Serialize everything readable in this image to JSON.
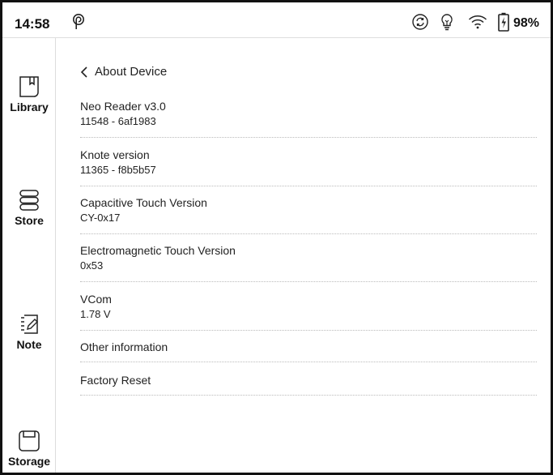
{
  "status_bar": {
    "time": "14:58",
    "battery_percent": "98%",
    "icons": [
      "push-notification-icon",
      "sync-icon",
      "lightbulb-icon",
      "wifi-icon",
      "battery-charging-icon"
    ]
  },
  "sidebar": {
    "items": [
      {
        "label": "Library",
        "icon": "library-icon"
      },
      {
        "label": "Store",
        "icon": "store-icon"
      },
      {
        "label": "Note",
        "icon": "note-icon"
      },
      {
        "label": "Storage",
        "icon": "storage-icon"
      }
    ]
  },
  "page": {
    "back_label": "About Device",
    "rows": [
      {
        "title": "Neo Reader v3.0",
        "value": "11548 - 6af1983"
      },
      {
        "title": "Knote version",
        "value": "11365 - f8b5b57"
      },
      {
        "title": "Capacitive Touch Version",
        "value": "CY-0x17"
      },
      {
        "title": "Electromagnetic Touch Version",
        "value": "0x53"
      },
      {
        "title": "VCom",
        "value": "1.78 V"
      },
      {
        "title": "Other information"
      },
      {
        "title": "Factory Reset"
      }
    ]
  }
}
